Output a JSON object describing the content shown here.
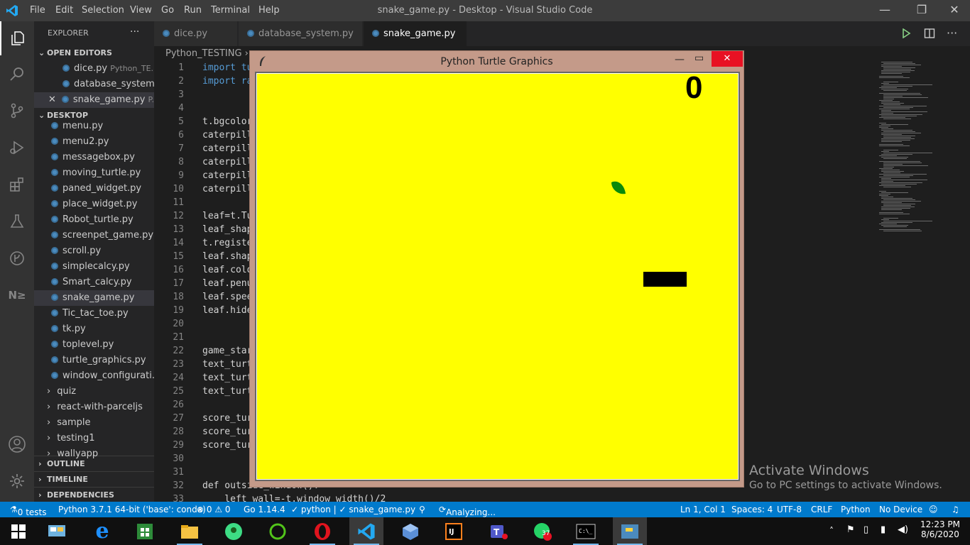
{
  "window": {
    "title": "snake_game.py - Desktop - Visual Studio Code"
  },
  "menu": [
    "File",
    "Edit",
    "Selection",
    "View",
    "Go",
    "Run",
    "Terminal",
    "Help"
  ],
  "sidebar": {
    "explorer_label": "EXPLORER",
    "more": "···",
    "open_editors": "OPEN EDITORS",
    "open_files": [
      {
        "name": "dice.py",
        "path": "Python_TE..."
      },
      {
        "name": "database_system....",
        "path": ""
      },
      {
        "name": "snake_game.py",
        "path": "P..."
      }
    ],
    "desktop": "DESKTOP",
    "files": [
      "menu.py",
      "menu2.py",
      "messagebox.py",
      "moving_turtle.py",
      "paned_widget.py",
      "place_widget.py",
      "Robot_turtle.py",
      "screenpet_game.py",
      "scroll.py",
      "simplecalcy.py",
      "Smart_calcy.py",
      "snake_game.py",
      "Tic_tac_toe.py",
      "tk.py",
      "toplevel.py",
      "turtle_graphics.py",
      "window_configurati..."
    ],
    "folders": [
      "quiz",
      "react-with-parceljs",
      "sample",
      "testing1",
      "wallyapp"
    ],
    "outline": "OUTLINE",
    "timeline": "TIMELINE",
    "dependencies": "DEPENDENCIES"
  },
  "tabs": [
    {
      "label": "dice.py"
    },
    {
      "label": "database_system.py"
    },
    {
      "label": "snake_game.py",
      "close": "✕"
    }
  ],
  "breadcrumb": "Python_TESTING  ›",
  "code": [
    {
      "n": "1",
      "t": "import tu",
      "kw": true
    },
    {
      "n": "2",
      "t": "import ra",
      "kw": true
    },
    {
      "n": "3",
      "t": ""
    },
    {
      "n": "4",
      "t": ""
    },
    {
      "n": "5",
      "t": "t.bgcolor"
    },
    {
      "n": "6",
      "t": "caterpill"
    },
    {
      "n": "7",
      "t": "caterpill"
    },
    {
      "n": "8",
      "t": "caterpill"
    },
    {
      "n": "9",
      "t": "caterpill"
    },
    {
      "n": "10",
      "t": "caterpill"
    },
    {
      "n": "11",
      "t": ""
    },
    {
      "n": "12",
      "t": "leaf=t.Tu"
    },
    {
      "n": "13",
      "t": "leaf_shap"
    },
    {
      "n": "14",
      "t": "t.registe"
    },
    {
      "n": "15",
      "t": "leaf.shap"
    },
    {
      "n": "16",
      "t": "leaf.colo"
    },
    {
      "n": "17",
      "t": "leaf.penu"
    },
    {
      "n": "18",
      "t": "leaf.spee"
    },
    {
      "n": "19",
      "t": "leaf.hide"
    },
    {
      "n": "20",
      "t": ""
    },
    {
      "n": "21",
      "t": ""
    },
    {
      "n": "22",
      "t": "game_star"
    },
    {
      "n": "23",
      "t": "text_turt"
    },
    {
      "n": "24",
      "t": "text_turt"
    },
    {
      "n": "25",
      "t": "text_turt"
    },
    {
      "n": "26",
      "t": ""
    },
    {
      "n": "27",
      "t": "score_tur"
    },
    {
      "n": "28",
      "t": "score_tur"
    },
    {
      "n": "29",
      "t": "score_tur"
    },
    {
      "n": "30",
      "t": ""
    },
    {
      "n": "31",
      "t": ""
    },
    {
      "n": "32",
      "t": "def outside_window():"
    },
    {
      "n": "33",
      "t": "    left_wall=-t.window_width()/2"
    }
  ],
  "turtle_window": {
    "title": "Python Turtle Graphics",
    "score": "0",
    "bg": "#ffff00"
  },
  "watermark": {
    "line1": "Activate Windows",
    "line2": "Go to PC settings to activate Windows."
  },
  "status": {
    "tests": "0 tests",
    "interpreter": "Python 3.7.1 64-bit ('base': conda)",
    "problems": "⊗ 0 ⚠ 0",
    "go": "Go 1.14.4",
    "python_check": "✓ python | ✓ snake_game.py",
    "analyzing": "Analyzing...",
    "position": "Ln 1, Col 1",
    "spaces": "Spaces: 4",
    "encoding": "UTF-8",
    "eol": "CRLF",
    "language": "Python",
    "device": "No Device"
  },
  "taskbar": {
    "time": "12:23 PM",
    "date": "8/6/2020",
    "whatsapp_badge": "37"
  },
  "colors": {
    "accent": "#007acc",
    "titlebar": "#3c3c3c",
    "turtle_frame": "#c49a89",
    "close_red": "#e81123"
  }
}
